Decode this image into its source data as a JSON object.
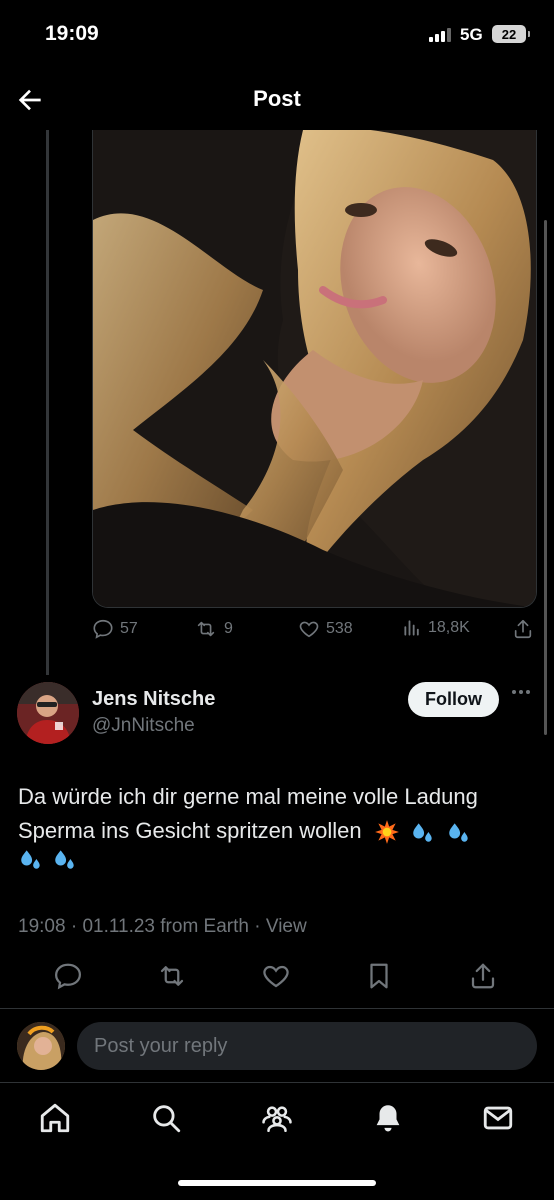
{
  "status_bar": {
    "time": "19:09",
    "network": "5G",
    "battery": "22"
  },
  "nav": {
    "title": "Post",
    "back_icon": "back-arrow-icon"
  },
  "parent_post": {
    "actions": {
      "replies": "57",
      "reposts": "9",
      "likes": "538",
      "views": "18,8K"
    }
  },
  "post": {
    "author_name": "Jens Nitsche",
    "author_handle": "@JnNitsche",
    "follow_label": "Follow",
    "text": "Da würde ich dir gerne mal meine volle Ladung Sperma ins Gesicht spritzen wollen",
    "emojis": [
      "collision-emoji",
      "sweat-droplets-emoji",
      "sweat-droplets-emoji",
      "sweat-droplets-emoji",
      "sweat-droplets-emoji"
    ],
    "time": "19:08",
    "date": "01.11.23",
    "source": "from Earth",
    "view_label": "View"
  },
  "reply": {
    "placeholder": "Post your reply"
  },
  "tabs": [
    "home-icon",
    "search-icon",
    "communities-icon",
    "notifications-icon",
    "messages-icon"
  ],
  "colors": {
    "background": "#000000",
    "text": "#e7e9ea",
    "muted": "#71767b",
    "divider": "#2f3336",
    "follow_bg": "#eff3f4",
    "input_bg": "#202327"
  }
}
